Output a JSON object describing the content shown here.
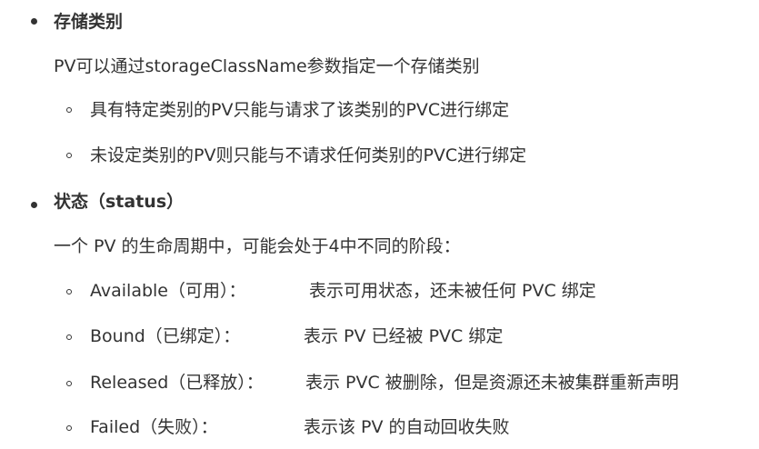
{
  "storage_class": {
    "title": "存储类别",
    "intro": "PV可以通过storageClassName参数指定一个存储类别",
    "items": [
      "具有特定类别的PV只能与请求了该类别的PVC进行绑定",
      "未设定类别的PV则只能与不请求任何类别的PVC进行绑定"
    ]
  },
  "status": {
    "title": "状态（status）",
    "intro": "一个 PV 的生命周期中，可能会处于4中不同的阶段：",
    "phases": [
      {
        "label": "Available（可用）：",
        "desc": "表示可用状态，还未被任何 PVC 绑定"
      },
      {
        "label": "Bound（已绑定）：",
        "desc": "表示 PV 已经被 PVC 绑定"
      },
      {
        "label": "Released（已释放）：",
        "desc": "表示 PVC 被删除，但是资源还未被集群重新声明"
      },
      {
        "label": "Failed（失败）：",
        "desc": "表示该 PV 的自动回收失败"
      }
    ]
  }
}
